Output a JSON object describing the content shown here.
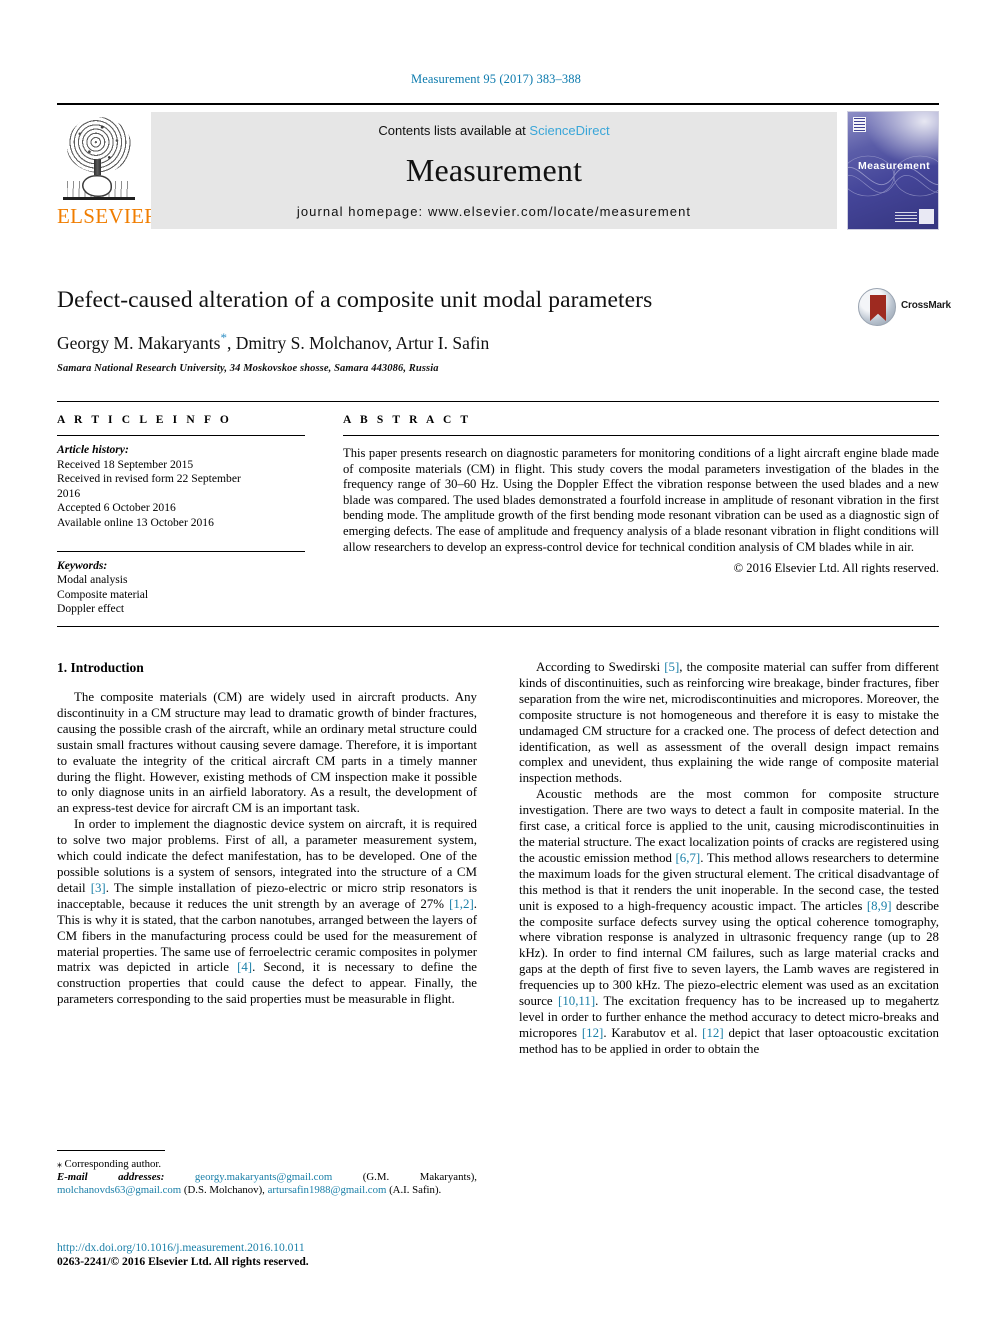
{
  "running_head": "Measurement 95 (2017) 383–388",
  "masthead": {
    "publisher_name": "ELSEVIER",
    "contents_prefix": "Contents lists available at ",
    "contents_link": "ScienceDirect",
    "journal_title": "Measurement",
    "journal_homepage": "journal homepage: www.elsevier.com/locate/measurement",
    "cover_word": "Measurement"
  },
  "article": {
    "title": "Defect-caused alteration of a composite unit modal parameters",
    "authors_pre": "Georgy M. Makaryants",
    "corresponding_star": "*",
    "authors_post": ", Dmitry S. Molchanov, Artur I. Safin",
    "affiliation": "Samara National Research University, 34 Moskovskoe shosse, Samara 443086, Russia",
    "crossmark_label": "CrossMark"
  },
  "info": {
    "heading": "A R T I C L E   I N F O",
    "history_label": "Article history:",
    "history": [
      "Received 18 September 2015",
      "Received in revised form 22 September",
      "2016",
      "Accepted 6 October 2016",
      "Available online 13 October 2016"
    ],
    "keywords_label": "Keywords:",
    "keywords": [
      "Modal analysis",
      "Composite material",
      "Doppler effect"
    ]
  },
  "abstract": {
    "heading": "A B S T R A C T",
    "text": "This paper presents research on diagnostic parameters for monitoring conditions of a light aircraft engine blade made of composite materials (CM) in flight. This study covers the modal parameters investigation of the blades in the frequency range of 30–60 Hz. Using the Doppler Effect the vibration response between the used blades and a new blade was compared. The used blades demonstrated a fourfold increase in amplitude of resonant vibration in the first bending mode. The amplitude growth of the first bending mode resonant vibration can be used as a diagnostic sign of emerging defects. The ease of amplitude and frequency analysis of a blade resonant vibration in flight conditions will allow researchers to develop an express-control device for technical condition analysis of CM blades while in air.",
    "rights": "© 2016 Elsevier Ltd. All rights reserved."
  },
  "body": {
    "section_heading": "1. Introduction",
    "left_paragraphs": [
      {
        "parts": [
          {
            "t": "The composite materials (CM) are widely used in aircraft products. Any discontinuity in a CM structure may lead to dramatic growth of binder fractures, causing the possible crash of the aircraft, while an ordinary metal structure could sustain small fractures without causing severe damage. Therefore, it is important to evaluate the integrity of the critical aircraft CM parts in a timely manner during the flight. However, existing methods of CM inspection make it possible to only diagnose units in an airfield laboratory. As a result, the development of an express-test device for aircraft CM is an important task."
          }
        ]
      },
      {
        "parts": [
          {
            "t": "In order to implement the diagnostic device system on aircraft, it is required to solve two major problems. First of all, a parameter measurement system, which could indicate the defect manifestation, has to be developed. One of the possible solutions is a system of sensors, integrated into the structure of a CM detail "
          },
          {
            "t": "[3]",
            "ref": true
          },
          {
            "t": ". The simple installation of piezo-electric or micro strip resonators is inacceptable, because it reduces the unit strength by an average of 27% "
          },
          {
            "t": "[1,2]",
            "ref": true
          },
          {
            "t": ". This is why it is stated, that the carbon nanotubes, arranged between the layers of CM fibers in the manufacturing process could be used for the measurement of material properties. The same use of ferroelectric ceramic composites in polymer matrix was depicted in article "
          },
          {
            "t": "[4]",
            "ref": true
          },
          {
            "t": ". Second, it is necessary to define the construction properties that could cause the defect to appear. Finally, the parameters corresponding to the said properties must be measurable in flight."
          }
        ]
      }
    ],
    "right_paragraphs": [
      {
        "parts": [
          {
            "t": "According to Swedirski "
          },
          {
            "t": "[5]",
            "ref": true
          },
          {
            "t": ", the composite material can suffer from different kinds of discontinuities, such as reinforcing wire breakage, binder fractures, fiber separation from the wire net, microdiscontinuities and micropores. Moreover, the composite structure is not homogeneous and therefore it is easy to mistake the undamaged CM structure for a cracked one. The process of defect detection and identification, as well as assessment of the overall design impact remains complex and unevident, thus explaining the wide range of composite material inspection methods."
          }
        ]
      },
      {
        "parts": [
          {
            "t": "Acoustic methods are the most common for composite structure investigation. There are two ways to detect a fault in composite material. In the first case, a critical force is applied to the unit, causing microdiscontinuities in the material structure. The exact localization points of cracks are registered using the acoustic emission method "
          },
          {
            "t": "[6,7]",
            "ref": true
          },
          {
            "t": ". This method allows researchers to determine the maximum loads for the given structural element. The critical disadvantage of this method is that it renders the unit inoperable. In the second case, the tested unit is exposed to a high-frequency acoustic impact. The articles "
          },
          {
            "t": "[8,9]",
            "ref": true
          },
          {
            "t": " describe the composite surface defects survey using the optical coherence tomography, where vibration response is analyzed in ultrasonic frequency range (up to 28 kHz). In order to find internal CM failures, such as large material cracks and gaps at the depth of first five to seven layers, the Lamb waves are registered in frequencies up to 300 kHz. The piezo-electric element was used as an excitation source "
          },
          {
            "t": "[10,11]",
            "ref": true
          },
          {
            "t": ". The excitation frequency has to be increased up to megahertz level in order to further enhance the method accuracy to detect micro-breaks and micropores "
          },
          {
            "t": "[12]",
            "ref": true
          },
          {
            "t": ". Karabutov et al. "
          },
          {
            "t": "[12]",
            "ref": true
          },
          {
            "t": " depict that laser optoacoustic excitation method has to be applied in order to obtain the"
          }
        ]
      }
    ]
  },
  "footnote": {
    "corresponding": "Corresponding author.",
    "email_label": "E-mail addresses:",
    "emails": [
      {
        "address": "georgy.makaryants@gmail.com",
        "owner": " (G.M. Makaryants), "
      },
      {
        "address": "molchanovds63@gmail.com",
        "owner": " (D.S. Molchanov), "
      },
      {
        "address": "artursafin1988@gmail.com",
        "owner": " (A.I. Safin)."
      }
    ]
  },
  "doi": {
    "url": "http://dx.doi.org/10.1016/j.measurement.2016.10.011",
    "issn_line": "0263-2241/© 2016 Elsevier Ltd. All rights reserved."
  },
  "colors": {
    "link": "#1a7fa8",
    "running_head": "#0b7aad",
    "elsevier_orange": "#f07d00",
    "sciencedirect": "#3aa6d8",
    "cover_purple": "#45469a",
    "crossmark_red": "#9e2a20"
  }
}
